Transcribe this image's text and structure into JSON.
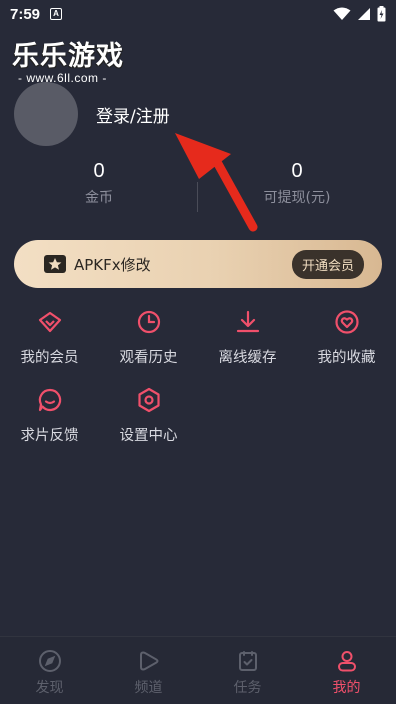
{
  "status_bar": {
    "time": "7:59",
    "notification_letter": "A"
  },
  "watermark": {
    "logo_text": "乐乐游戏",
    "url_text": "- www.6ll.com -"
  },
  "profile": {
    "login_label": "登录/注册"
  },
  "stats": [
    {
      "value": "0",
      "label": "金币"
    },
    {
      "value": "0",
      "label": "可提现(元)"
    }
  ],
  "vip": {
    "title": "APKFx修改",
    "button_label": "开通会员"
  },
  "menu": [
    {
      "label": "我的会员",
      "icon": "diamond-icon"
    },
    {
      "label": "观看历史",
      "icon": "clock-icon"
    },
    {
      "label": "离线缓存",
      "icon": "download-icon"
    },
    {
      "label": "我的收藏",
      "icon": "heart-icon"
    },
    {
      "label": "求片反馈",
      "icon": "chat-icon"
    },
    {
      "label": "设置中心",
      "icon": "settings-icon"
    }
  ],
  "tabs": [
    {
      "label": "发现",
      "icon": "compass-icon"
    },
    {
      "label": "频道",
      "icon": "play-icon"
    },
    {
      "label": "任务",
      "icon": "task-icon"
    },
    {
      "label": "我的",
      "icon": "user-icon",
      "active": true
    }
  ],
  "colors": {
    "accent": "#f0506b",
    "background": "#272a38",
    "vip_gold": "#e9d1b1",
    "inactive": "#5d606c"
  }
}
